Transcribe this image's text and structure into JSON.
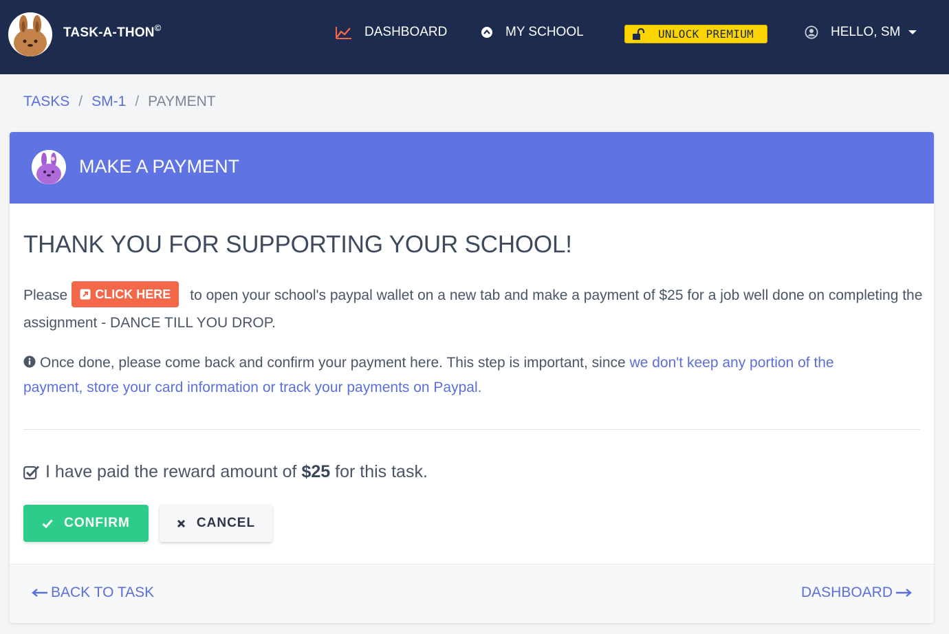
{
  "navbar": {
    "brand_name": "TASK-A-THON",
    "brand_mark": "©",
    "brand_avatar_icon": "bunny-mascot-icon",
    "dashboard_label": "DASHBOARD",
    "dashboard_icon": "chart-line-icon",
    "school_label": "MY SCHOOL",
    "school_icon": "circle-chevron-up-icon",
    "premium_label": "UNLOCK PREMIUM",
    "premium_icon": "unlock-icon",
    "user_label": "HELLO, SM",
    "user_icon": "user-circle-icon",
    "colors": {
      "background": "#1c2b4e",
      "premium": "#fcd400",
      "dashboard_icon": "#f4684a"
    }
  },
  "breadcrumb": {
    "items": [
      "TASKS",
      "SM-1"
    ],
    "separator": "/",
    "current": "PAYMENT"
  },
  "card": {
    "title": "MAKE A PAYMENT",
    "header_color": "#5f73e2",
    "header_avatar_icon": "purple-bunny-icon",
    "heading": "THANK YOU FOR SUPPORTING YOUR SCHOOL!",
    "para1": {
      "before": "Please",
      "button_label": "CLICK HERE",
      "button_icon": "external-link-icon",
      "after": "to open your school's paypal wallet on a new tab and make a payment of $25 for a job well done on completing the assignment - DANCE TILL YOU DROP."
    },
    "para2": {
      "icon": "info-circle-icon",
      "text": "Once done, please come back and confirm your payment here. This step is important, since",
      "link": "we don't keep any portion of the payment, store your card information or track your payments on Paypal."
    },
    "paid": {
      "icon": "checked-box-icon",
      "before": "I have paid the reward amount of",
      "amount": "$25",
      "after": "for this task."
    },
    "confirm_label": "CONFIRM",
    "confirm_color": "#2ecc8a",
    "cancel_label": "CANCEL",
    "footer": {
      "back_label": "BACK TO TASK",
      "dashboard_label": "DASHBOARD"
    }
  }
}
